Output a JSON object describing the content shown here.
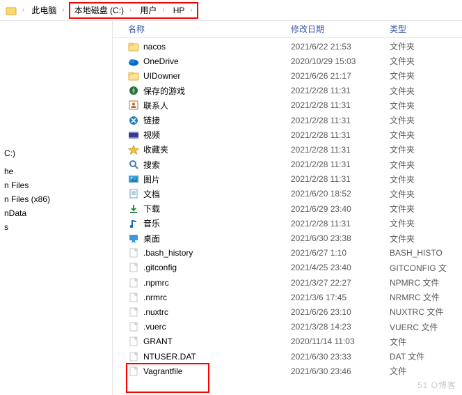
{
  "breadcrumb": {
    "items": [
      "此电脑",
      "本地磁盘 (C:)",
      "用户",
      "HP"
    ]
  },
  "sidebar": {
    "items": [
      "C:)",
      "",
      "he",
      "n Files",
      "n Files (x86)",
      "nData",
      "s"
    ]
  },
  "columns": {
    "name": "名称",
    "date": "修改日期",
    "type": "类型"
  },
  "rows": [
    {
      "icon": "folder",
      "name": "nacos",
      "date": "2021/6/22 21:53",
      "type": "文件夹"
    },
    {
      "icon": "onedrive",
      "name": "OneDrive",
      "date": "2020/10/29 15:03",
      "type": "文件夹"
    },
    {
      "icon": "folder",
      "name": "UIDowner",
      "date": "2021/6/26 21:17",
      "type": "文件夹"
    },
    {
      "icon": "games",
      "name": "保存的游戏",
      "date": "2021/2/28 11:31",
      "type": "文件夹"
    },
    {
      "icon": "contacts",
      "name": "联系人",
      "date": "2021/2/28 11:31",
      "type": "文件夹"
    },
    {
      "icon": "links",
      "name": "链接",
      "date": "2021/2/28 11:31",
      "type": "文件夹"
    },
    {
      "icon": "videos",
      "name": "视频",
      "date": "2021/2/28 11:31",
      "type": "文件夹"
    },
    {
      "icon": "favorites",
      "name": "收藏夹",
      "date": "2021/2/28 11:31",
      "type": "文件夹"
    },
    {
      "icon": "search",
      "name": "搜索",
      "date": "2021/2/28 11:31",
      "type": "文件夹"
    },
    {
      "icon": "pictures",
      "name": "图片",
      "date": "2021/2/28 11:31",
      "type": "文件夹"
    },
    {
      "icon": "documents",
      "name": "文档",
      "date": "2021/6/20 18:52",
      "type": "文件夹"
    },
    {
      "icon": "downloads",
      "name": "下载",
      "date": "2021/6/29 23:40",
      "type": "文件夹"
    },
    {
      "icon": "music",
      "name": "音乐",
      "date": "2021/2/28 11:31",
      "type": "文件夹"
    },
    {
      "icon": "desktop",
      "name": "桌面",
      "date": "2021/6/30 23:38",
      "type": "文件夹"
    },
    {
      "icon": "file",
      "name": ".bash_history",
      "date": "2021/6/27 1:10",
      "type": "BASH_HISTO"
    },
    {
      "icon": "file",
      "name": ".gitconfig",
      "date": "2021/4/25 23:40",
      "type": "GITCONFIG 文"
    },
    {
      "icon": "file",
      "name": ".npmrc",
      "date": "2021/3/27 22:27",
      "type": "NPMRC 文件"
    },
    {
      "icon": "file",
      "name": ".nrmrc",
      "date": "2021/3/6 17:45",
      "type": "NRMRC 文件"
    },
    {
      "icon": "file",
      "name": ".nuxtrc",
      "date": "2021/6/26 23:10",
      "type": "NUXTRC 文件"
    },
    {
      "icon": "file",
      "name": ".vuerc",
      "date": "2021/3/28 14:23",
      "type": "VUERC 文件"
    },
    {
      "icon": "file",
      "name": "GRANT",
      "date": "2020/11/14 11:03",
      "type": "文件"
    },
    {
      "icon": "file",
      "name": "NTUSER.DAT",
      "date": "2021/6/30 23:33",
      "type": "DAT 文件"
    },
    {
      "icon": "file",
      "name": "Vagrantfile",
      "date": "2021/6/30 23:46",
      "type": "文件"
    }
  ],
  "watermark": "51 O博客"
}
